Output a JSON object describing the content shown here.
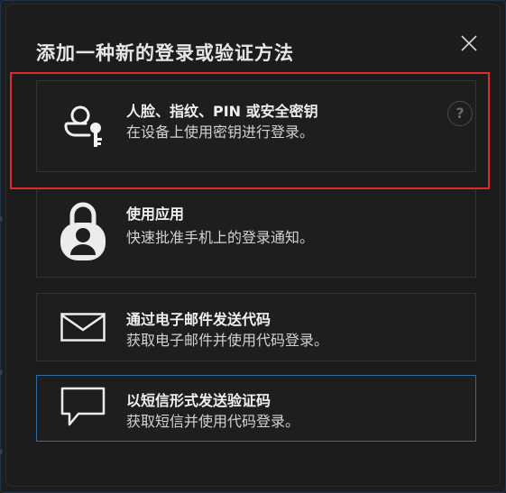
{
  "dialog": {
    "title": "添加一种新的登录或验证方法",
    "close_icon": "close-icon"
  },
  "options": [
    {
      "title": "人脸、指纹、PIN 或安全密钥",
      "desc": "在设备上使用密钥进行登录。",
      "icon": "passkey-user-key-icon"
    },
    {
      "title": "使用应用",
      "desc": "快速批准手机上的登录通知。",
      "icon": "authenticator-app-lock-icon"
    },
    {
      "title": "通过电子邮件发送代码",
      "desc": "获取电子邮件并使用代码登录。",
      "icon": "envelope-icon"
    },
    {
      "title": "以短信形式发送验证码",
      "desc": "获取短信并使用代码登录。",
      "icon": "chat-bubble-icon"
    }
  ],
  "help": {
    "label": "?",
    "icon": "help-icon"
  },
  "colors": {
    "background": "#1c1c1c",
    "card_border": "#333333",
    "selected_border": "#2c6aa8",
    "highlight": "#e0282e",
    "text": "#f0f0f0"
  }
}
